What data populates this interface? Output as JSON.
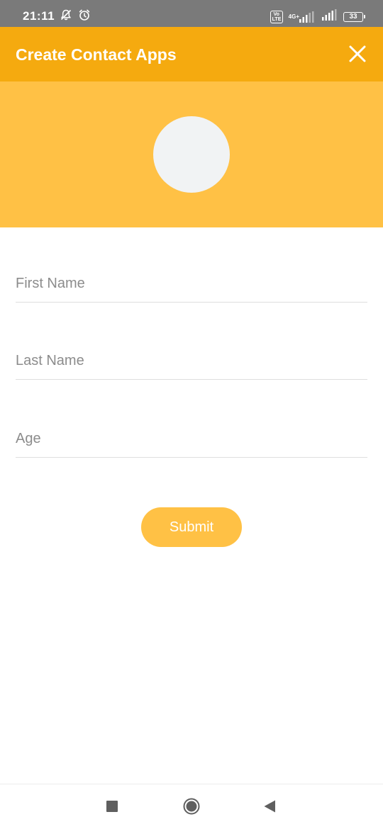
{
  "status_bar": {
    "time": "21:11",
    "left_icons": [
      "notifications-off-icon",
      "alarm-icon"
    ],
    "volte_label": "Vo LTE",
    "network_type": "4G+",
    "battery_level": "33"
  },
  "app_bar": {
    "title": "Create Contact Apps",
    "close_icon": "close-icon"
  },
  "form": {
    "first_name": {
      "placeholder": "First Name",
      "value": ""
    },
    "last_name": {
      "placeholder": "Last Name",
      "value": ""
    },
    "age": {
      "placeholder": "Age",
      "value": ""
    },
    "submit_label": "Submit"
  },
  "nav_bar": {
    "icons": [
      "recent-apps-icon",
      "home-icon",
      "back-icon"
    ]
  },
  "colors": {
    "app_bar": "#f5aa0f",
    "header": "#ffc145",
    "avatar": "#f1f3f4",
    "submit": "#ffc145"
  }
}
